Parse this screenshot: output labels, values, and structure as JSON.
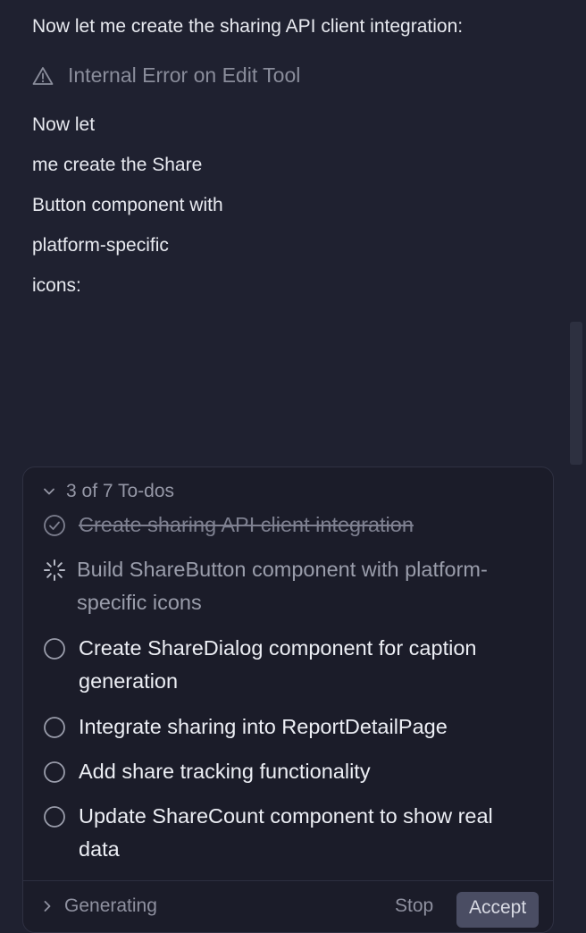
{
  "chat": {
    "intro": "Now let me create the sharing API client integration:",
    "error": "Internal Error on Edit Tool",
    "lines": [
      "Now let",
      "me create the Share",
      "Button component with",
      "platform-specific",
      "icons:"
    ]
  },
  "todos": {
    "header": "3 of 7 To-dos",
    "items": [
      {
        "label": "Create sharing API client integration",
        "status": "done"
      },
      {
        "label": "Build ShareButton component with platform-specific icons",
        "status": "in-progress"
      },
      {
        "label": "Create ShareDialog component for caption generation",
        "status": "pending"
      },
      {
        "label": "Integrate sharing into ReportDetailPage",
        "status": "pending"
      },
      {
        "label": "Add share tracking functionality",
        "status": "pending"
      },
      {
        "label": "Update ShareCount component to show real data",
        "status": "pending"
      }
    ]
  },
  "footer": {
    "status": "Generating",
    "stop_label": "Stop",
    "accept_label": "Accept"
  }
}
